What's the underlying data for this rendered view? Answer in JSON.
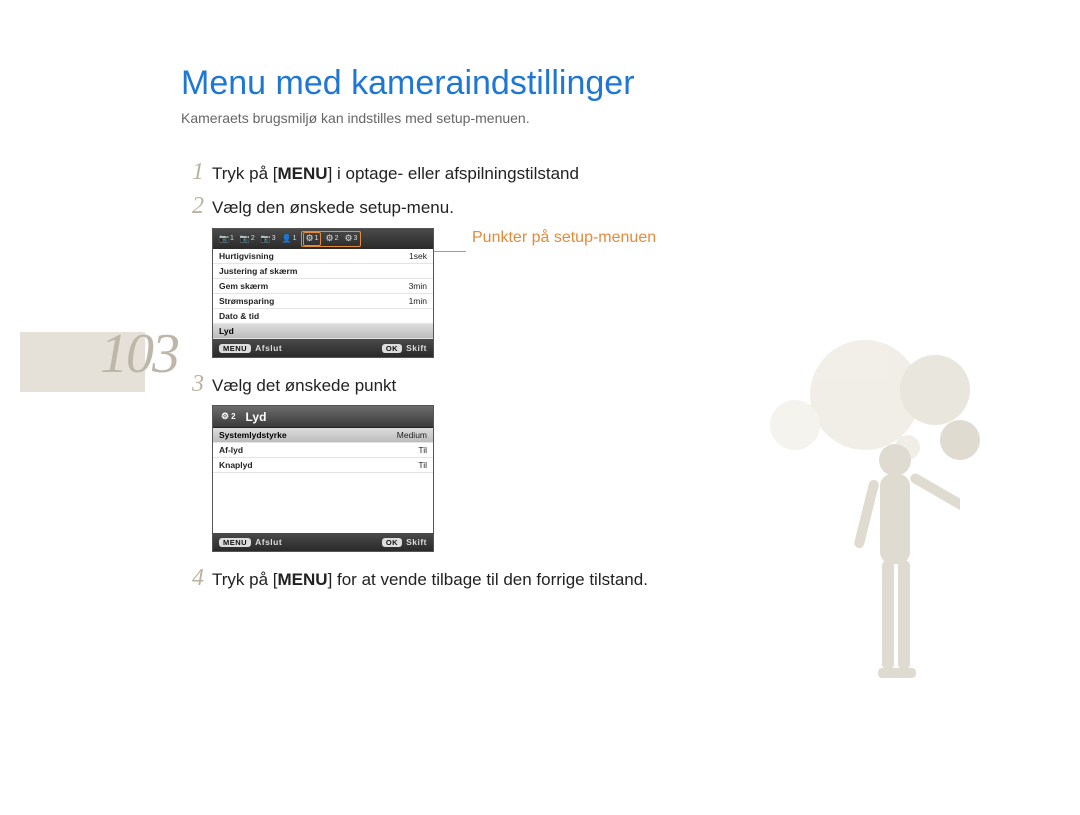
{
  "page_number": "103",
  "title": "Menu med kameraindstillinger",
  "subtitle": "Kameraets brugsmiljø kan indstilles med setup-menuen.",
  "steps": {
    "s1": {
      "num": "1",
      "pre": "Tryk på [",
      "bold": "MENU",
      "post": "] i optage- eller afspilningstilstand"
    },
    "s2": {
      "num": "2",
      "text": "Vælg den ønskede setup-menu."
    },
    "s3": {
      "num": "3",
      "text": "Vælg det ønskede punkt"
    },
    "s4": {
      "num": "4",
      "pre": "Tryk på [",
      "bold": "MENU",
      "post": "] for at vende tilbage til den forrige tilstand."
    }
  },
  "callout": "Punkter på setup-menuen",
  "screen1": {
    "tabs": {
      "cam1": "1",
      "cam2": "2",
      "cam3": "3",
      "user": "1",
      "g1": "1",
      "g2": "2",
      "g3": "3"
    },
    "rows": [
      {
        "k": "Hurtigvisning",
        "v": "1sek"
      },
      {
        "k": "Justering af skærm",
        "v": ""
      },
      {
        "k": "Gem skærm",
        "v": "3min"
      },
      {
        "k": "Strømsparing",
        "v": "1min"
      },
      {
        "k": "Dato & tid",
        "v": ""
      },
      {
        "k": "Lyd",
        "v": "",
        "sel": true
      }
    ],
    "footer": {
      "menu": "MENU",
      "afslut": "Afslut",
      "ok": "OK",
      "skift": "Skift"
    }
  },
  "screen2": {
    "header_icon_num": "2",
    "header": "Lyd",
    "rows": [
      {
        "k": "Systemlydstyrke",
        "v": "Medium",
        "sel": true
      },
      {
        "k": "Af-lyd",
        "v": "Til"
      },
      {
        "k": "Knaplyd",
        "v": "Til"
      }
    ],
    "footer": {
      "menu": "MENU",
      "afslut": "Afslut",
      "ok": "OK",
      "skift": "Skift"
    }
  }
}
